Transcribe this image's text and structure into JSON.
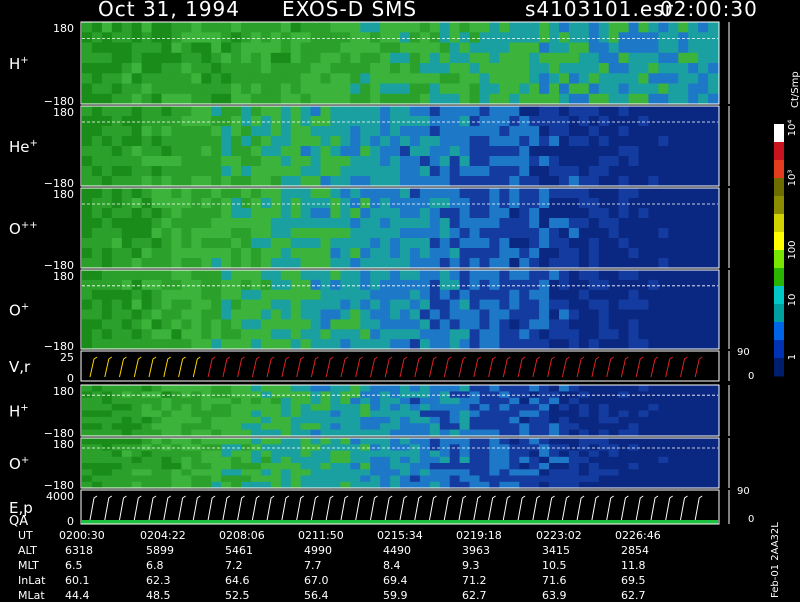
{
  "header": {
    "date": "Oct 31, 1994",
    "instrument": "EXOS-D SMS",
    "file": "s4103101.esr",
    "time": "02:00:30"
  },
  "side": {
    "cb_unit": "Ct/Smp",
    "footer": "Feb-01 2AA32L"
  },
  "colorbar": {
    "labels": [
      "10⁴",
      "10³",
      "100",
      "10",
      "1"
    ],
    "stops": [
      "#ffffff",
      "#c8141e",
      "#e63c1e",
      "#6e6e00",
      "#8c8c00",
      "#d2d200",
      "#ffff00",
      "#78e600",
      "#28b400",
      "#00c8c8",
      "#00a0a0",
      "#0064e6",
      "#0032b4",
      "#001e6e"
    ]
  },
  "chart_data": {
    "type": "heatmap",
    "panels": [
      {
        "label": "H",
        "sup": "+",
        "kind": "spec",
        "ymax": "180",
        "ymin": "−180"
      },
      {
        "label": "He",
        "sup": "+",
        "kind": "spec",
        "ymax": "180",
        "ymin": "−180"
      },
      {
        "label": "O",
        "sup": "++",
        "kind": "spec",
        "ymax": "180",
        "ymin": "−180"
      },
      {
        "label": "O",
        "sup": "+",
        "kind": "spec",
        "ymax": "180",
        "ymin": "−180"
      },
      {
        "label": "V,r",
        "sup": "",
        "kind": "line",
        "ymax": "25",
        "ymin": "0",
        "right_top": "90",
        "right_bot": "0"
      },
      {
        "label": "H",
        "sup": "+",
        "kind": "spec",
        "ymax": "180",
        "ymin": "−180"
      },
      {
        "label": "O",
        "sup": "+",
        "kind": "spec",
        "ymax": "180",
        "ymin": "−180"
      },
      {
        "label": "E,p",
        "sub": "QA",
        "kind": "line",
        "ymax": "4000",
        "ymin": "0",
        "right_top": "90",
        "right_bot": "0"
      }
    ],
    "table": {
      "rows": [
        {
          "name": "UT",
          "values": [
            "0200:30",
            "0204:22",
            "0208:06",
            "0211:50",
            "0215:34",
            "0219:18",
            "0223:02",
            "0226:46"
          ]
        },
        {
          "name": "ALT",
          "values": [
            "6318",
            "5899",
            "5461",
            "4990",
            "4490",
            "3963",
            "3415",
            "2854"
          ]
        },
        {
          "name": "MLT",
          "values": [
            "6.5",
            "6.8",
            "7.2",
            "7.7",
            "8.4",
            "9.3",
            "10.5",
            "11.8"
          ]
        },
        {
          "name": "InLat",
          "values": [
            "60.1",
            "62.3",
            "64.6",
            "67.0",
            "69.4",
            "71.2",
            "71.6",
            "69.5"
          ]
        },
        {
          "name": "MLat",
          "values": [
            "44.4",
            "48.5",
            "52.5",
            "56.4",
            "59.9",
            "62.7",
            "63.9",
            "62.7"
          ]
        }
      ]
    }
  }
}
